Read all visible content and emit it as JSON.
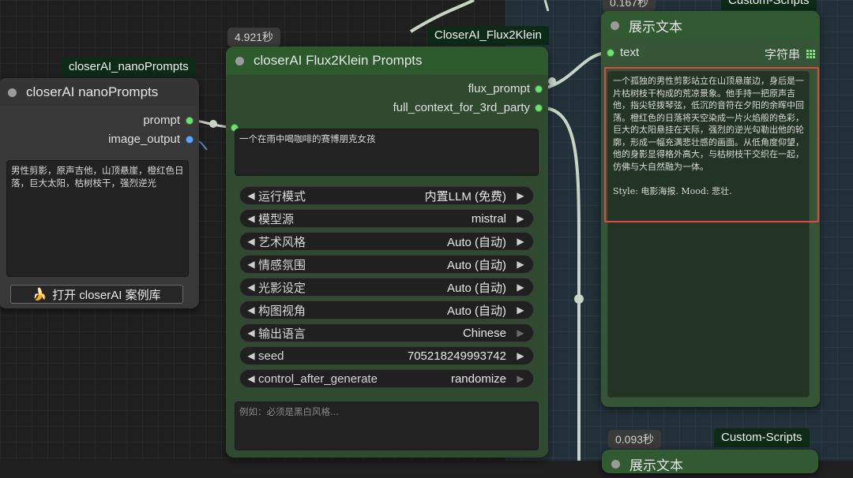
{
  "colors": {
    "canvas": "#202020",
    "group_region": "#22303a",
    "node_green": "#2f4a2f",
    "node_gray": "#383838",
    "link_white": "#c8d4c4",
    "link_blue": "#5a8fc8",
    "port_green": "#6ee06e",
    "port_blue": "#5aa8ff",
    "highlight_red": "#e04848"
  },
  "badges": {
    "nano_title": "closerAI_nanoPrompts",
    "flux_time": "4.921秒",
    "flux_title": "CloserAI_Flux2Klein",
    "show_time": "0.167秒",
    "show_title": "Custom-Scripts",
    "show2_time": "0.093秒",
    "show2_title": "Custom-Scripts"
  },
  "nano_node": {
    "title": "closerAI nanoPrompts",
    "outputs": [
      {
        "label": "prompt",
        "color": "green"
      },
      {
        "label": "image_output",
        "color": "blue"
      }
    ],
    "text": "男性剪影，原声吉他，山顶悬崖，橙红色日落，巨大太阳，枯树枝干，强烈逆光",
    "button_icon": "banana-icon",
    "button_label": "打开 closerAI 案例库"
  },
  "flux_node": {
    "title": "closerAI Flux2Klein Prompts",
    "outputs": [
      "flux_prompt",
      "full_context_for_3rd_party"
    ],
    "input_text": "一个在雨中喝咖啡的赛博朋克女孩",
    "widgets": [
      {
        "label": "运行模式",
        "value": "内置LLM (免费)",
        "right_enabled": true
      },
      {
        "label": "模型源",
        "value": "mistral",
        "right_enabled": true
      },
      {
        "label": "艺术风格",
        "value": "Auto (自动)",
        "right_enabled": true
      },
      {
        "label": "情感氛围",
        "value": "Auto (自动)",
        "right_enabled": true
      },
      {
        "label": "光影设定",
        "value": "Auto (自动)",
        "right_enabled": true
      },
      {
        "label": "构图视角",
        "value": "Auto (自动)",
        "right_enabled": true
      },
      {
        "label": "输出语言",
        "value": "Chinese",
        "right_enabled": false
      },
      {
        "label": "seed",
        "value": "705218249993742",
        "right_enabled": true
      },
      {
        "label": "control_after_generate",
        "value": "randomize",
        "right_enabled": false
      }
    ],
    "extra_placeholder": "例如：必须是黑白风格..."
  },
  "show_node": {
    "title": "展示文本",
    "input_label": "text",
    "type_label": "字符串",
    "text": "一个孤独的男性剪影站立在山顶悬崖边，身后是一片枯树枝干构成的荒凉景象。他手持一把原声吉他，指尖轻拨琴弦，低沉的音符在夕阳的余晖中回荡。橙红色的日落将天空染成一片火焰般的色彩，巨大的太阳悬挂在天际，强烈的逆光勾勒出他的轮廓，形成一幅充满悲壮感的画面。从低角度仰望，他的身影显得格外高大，与枯树枝干交织在一起，仿佛与大自然融为一体。\n\nStyle: 电影海报. Mood: 悲壮."
  },
  "show_node_2": {
    "title": "展示文本"
  }
}
